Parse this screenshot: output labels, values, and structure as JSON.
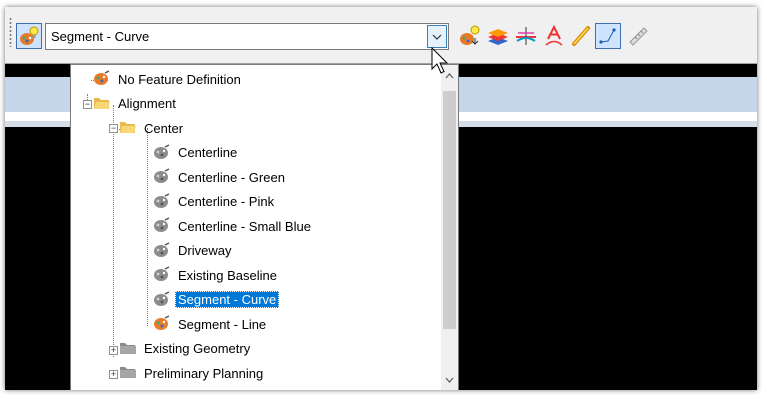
{
  "combo": {
    "selected": "Segment - Curve"
  },
  "toolbar": {
    "icons": [
      "feature-definition-icon",
      "feature-toggle-icon",
      "layers-icon",
      "cross-section-icon",
      "text-annotation-icon",
      "link-icon",
      "line-string-icon",
      "ruler-icon"
    ]
  },
  "tree": [
    {
      "label": "No Feature Definition",
      "icon": "palette-icon"
    },
    {
      "label": "Alignment",
      "icon": "folder-open-icon"
    },
    {
      "label": "Center",
      "icon": "folder-open-icon"
    },
    {
      "label": "Centerline",
      "icon": "palette-gray-icon"
    },
    {
      "label": "Centerline - Green",
      "icon": "palette-gray-icon"
    },
    {
      "label": "Centerline - Pink",
      "icon": "palette-gray-icon"
    },
    {
      "label": "Centerline - Small Blue",
      "icon": "palette-gray-icon"
    },
    {
      "label": "Driveway",
      "icon": "palette-gray-icon"
    },
    {
      "label": "Existing Baseline",
      "icon": "palette-gray-icon"
    },
    {
      "label": "Segment - Curve",
      "icon": "palette-gray-icon",
      "selected": true
    },
    {
      "label": "Segment - Line",
      "icon": "palette-icon"
    },
    {
      "label": "Existing Geometry",
      "icon": "folder-gray-icon"
    },
    {
      "label": "Preliminary Planning",
      "icon": "folder-gray-icon"
    }
  ],
  "colors": {
    "selection": "#0078d7",
    "folder": "#f8d775",
    "palette": "#e87b2a"
  }
}
